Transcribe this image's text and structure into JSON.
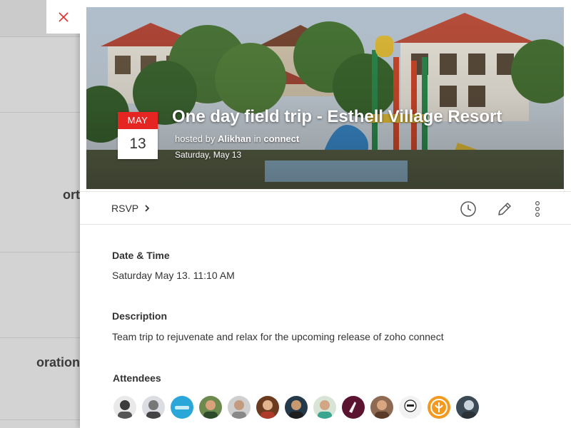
{
  "background_list": {
    "rows": [
      {
        "text": ""
      },
      {
        "text": "ort"
      },
      {
        "text": ""
      },
      {
        "text": "oration"
      }
    ]
  },
  "panel": {
    "close_icon": "close-icon",
    "event": {
      "month": "MAY",
      "day": "13",
      "title": "One day field trip - Esthell Village Resort",
      "hosted_prefix": "hosted by",
      "host": "Alikhan",
      "in_word": "in",
      "group": "connect",
      "date_line": "Saturday, May 13"
    },
    "toolbar": {
      "rsvp_label": "RSVP",
      "icons": [
        "clock-icon",
        "pencil-icon",
        "more-vertical-icon"
      ]
    },
    "details": {
      "date_time_label": "Date & Time",
      "date_time_value": "Saturday May 13.  11:10 AM",
      "description_label": "Description",
      "description_value": "Team trip to rejuvenate and relax for the upcoming release of zoho connect",
      "attendees_label": "Attendees",
      "attendee_count_shown": 13
    }
  },
  "colors": {
    "accent_red": "#e52521",
    "close_x": "#e0312e"
  }
}
